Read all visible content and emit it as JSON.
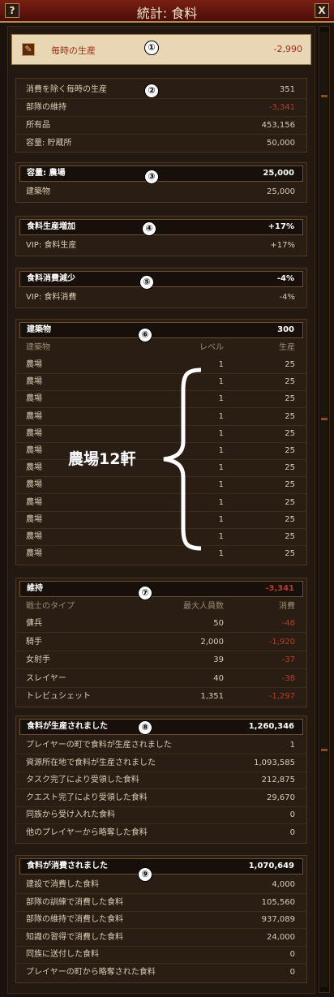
{
  "window": {
    "title": "統計: 食料",
    "help_label": "?",
    "close_label": "X"
  },
  "production": {
    "label": "毎時の生産",
    "value": "-2,990",
    "badge": "①"
  },
  "summary": {
    "badge": "②",
    "rows": [
      {
        "label": "消費を除く毎時の生産",
        "value": "351",
        "negative": false
      },
      {
        "label": "部隊の維持",
        "value": "-3,341",
        "negative": true
      },
      {
        "label": "所有品",
        "value": "453,156",
        "negative": false
      },
      {
        "label": "容量: 貯蔵所",
        "value": "50,000",
        "negative": false
      }
    ]
  },
  "capacity": {
    "badge": "③",
    "header": {
      "label": "容量: 農場",
      "value": "25,000"
    },
    "rows": [
      {
        "label": "建築物",
        "value": "25,000"
      }
    ]
  },
  "increase": {
    "badge": "④",
    "header": {
      "label": "食料生産増加",
      "value": "+17%"
    },
    "rows": [
      {
        "label": "VIP: 食料生産",
        "value": "+17%"
      }
    ]
  },
  "decrease": {
    "badge": "⑤",
    "header": {
      "label": "食料消費減少",
      "value": "-4%"
    },
    "rows": [
      {
        "label": "VIP: 食料消費",
        "value": "-4%"
      }
    ]
  },
  "buildings": {
    "badge": "⑥",
    "header": {
      "label": "建築物",
      "value": "300"
    },
    "columns": {
      "name": "建築物",
      "level": "レベル",
      "production": "生産"
    },
    "rows": [
      {
        "name": "農場",
        "level": "1",
        "production": "25"
      },
      {
        "name": "農場",
        "level": "1",
        "production": "25"
      },
      {
        "name": "農場",
        "level": "1",
        "production": "25"
      },
      {
        "name": "農場",
        "level": "1",
        "production": "25"
      },
      {
        "name": "農場",
        "level": "1",
        "production": "25"
      },
      {
        "name": "農場",
        "level": "1",
        "production": "25"
      },
      {
        "name": "農場",
        "level": "1",
        "production": "25"
      },
      {
        "name": "農場",
        "level": "1",
        "production": "25"
      },
      {
        "name": "農場",
        "level": "1",
        "production": "25"
      },
      {
        "name": "農場",
        "level": "1",
        "production": "25"
      },
      {
        "name": "農場",
        "level": "1",
        "production": "25"
      },
      {
        "name": "農場",
        "level": "1",
        "production": "25"
      }
    ],
    "annotation": "農場12軒"
  },
  "upkeep": {
    "badge": "⑦",
    "header": {
      "label": "維持",
      "value": "-3,341"
    },
    "columns": {
      "type": "戦士のタイプ",
      "max": "最大人員数",
      "consumption": "消費"
    },
    "rows": [
      {
        "type": "傭兵",
        "max": "50",
        "consumption": "-48"
      },
      {
        "type": "騎手",
        "max": "2,000",
        "consumption": "-1,920"
      },
      {
        "type": "女射手",
        "max": "39",
        "consumption": "-37"
      },
      {
        "type": "スレイヤー",
        "max": "40",
        "consumption": "-38"
      },
      {
        "type": "トレビュシェット",
        "max": "1,351",
        "consumption": "-1,297"
      }
    ]
  },
  "produced": {
    "badge": "⑧",
    "header": {
      "label": "食料が生産されました",
      "value": "1,260,346"
    },
    "rows": [
      {
        "label": "プレイヤーの町で食料が生産されました",
        "value": "1"
      },
      {
        "label": "資源所在地で食料が生産されました",
        "value": "1,093,585"
      },
      {
        "label": "タスク完了により受領した食料",
        "value": "212,875"
      },
      {
        "label": "クエスト完了により受領した食料",
        "value": "29,670"
      },
      {
        "label": "同族から受け入れた食料",
        "value": "0"
      },
      {
        "label": "他のプレイヤーから略奪した食料",
        "value": "0"
      }
    ]
  },
  "consumed": {
    "badge": "⑨",
    "header": {
      "label": "食料が消費されました",
      "value": "1,070,649"
    },
    "rows": [
      {
        "label": "建設で消費した食料",
        "value": "4,000"
      },
      {
        "label": "部隊の訓練で消費した食料",
        "value": "105,560"
      },
      {
        "label": "部隊の維持で消費した食料",
        "value": "937,089"
      },
      {
        "label": "知識の習得で消費した食料",
        "value": "24,000"
      },
      {
        "label": "同族に送付した食料",
        "value": "0"
      },
      {
        "label": "プレイヤーの町から略奪された食料",
        "value": "0"
      }
    ]
  },
  "colors": {
    "negative": "#b83a2a",
    "title_bar": "#7a1f14",
    "panel": "#2a1e14",
    "gold": "#b08a4a"
  }
}
